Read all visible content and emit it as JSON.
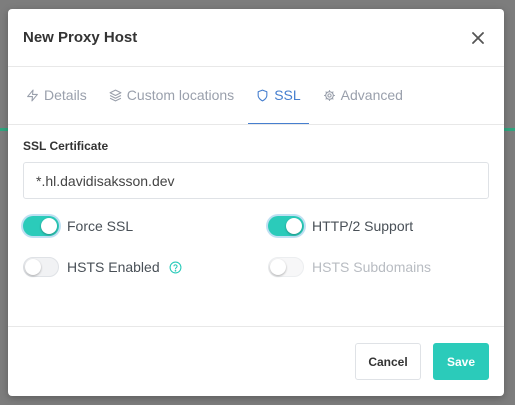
{
  "modal": {
    "title": "New Proxy Host",
    "close_icon": "close-icon"
  },
  "tabs": [
    {
      "label": "Details",
      "icon": "lightning-icon",
      "active": false
    },
    {
      "label": "Custom locations",
      "icon": "layers-icon",
      "active": false
    },
    {
      "label": "SSL",
      "icon": "shield-icon",
      "active": true
    },
    {
      "label": "Advanced",
      "icon": "gear-icon",
      "active": false
    }
  ],
  "ssl": {
    "certificate_label": "SSL Certificate",
    "certificate_value": "*.hl.davidisaksson.dev",
    "force_ssl": {
      "label": "Force SSL",
      "enabled": true
    },
    "http2": {
      "label": "HTTP/2 Support",
      "enabled": true
    },
    "hsts": {
      "label": "HSTS Enabled",
      "enabled": false,
      "help_icon": "question-circle-icon"
    },
    "hsts_subdomains": {
      "label": "HSTS Subdomains",
      "enabled": false,
      "disabled": true
    }
  },
  "footer": {
    "cancel_label": "Cancel",
    "save_label": "Save"
  },
  "colors": {
    "accent": "#2bcbba",
    "tab_active": "#467fcf",
    "tab_inactive": "#9aa0ac"
  }
}
